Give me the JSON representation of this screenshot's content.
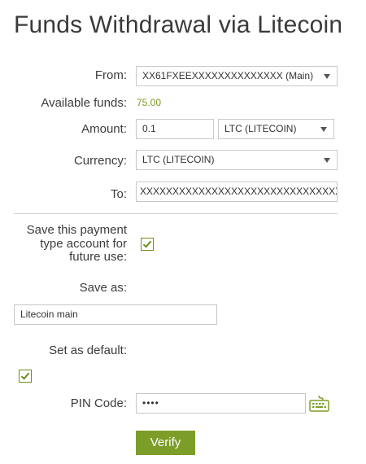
{
  "page": {
    "title": "Funds Withdrawal via Litecoin"
  },
  "form": {
    "from_label": "From:",
    "from_value": "XX61FXEEXXXXXXXXXXXXXX (Main)",
    "available_label": "Available funds:",
    "available_value": "75.00",
    "amount_label": "Amount:",
    "amount_value": "0.1",
    "amount_currency": "LTC (LITECOIN)",
    "currency_label": "Currency:",
    "currency_value": "LTC (LITECOIN)",
    "to_label": "To:",
    "to_value": "XXXXXXXXXXXXXXXXXXXXXXXXXXXXXXXXXXX",
    "save_type_label": "Save this payment type account for future use:",
    "save_type_checked": true,
    "save_as_label": "Save as:",
    "save_as_value": "Litecoin main",
    "default_label": "Set as default:",
    "default_checked": true,
    "pin_label": "PIN Code:",
    "pin_value": "••••",
    "verify_label": "Verify"
  },
  "colors": {
    "accent": "#7c9d28",
    "funds": "#7a9a1f"
  },
  "icons": {
    "keyboard": "keyboard-icon",
    "check": "check-icon",
    "dropdown": "chevron-down-icon"
  }
}
